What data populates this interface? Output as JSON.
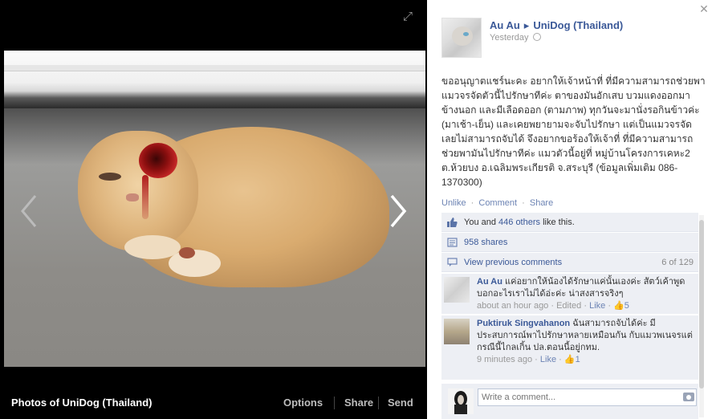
{
  "stage": {
    "album_title": "Photos of UniDog (Thailand)",
    "options_label": "Options",
    "share_label": "Share",
    "send_label": "Send"
  },
  "post": {
    "author": "Au Au",
    "target_page": "UniDog (Thailand)",
    "time": "Yesterday",
    "text": "ขออนุญาตแชร์นะคะ อยากให้เจ้าหน้าที่ ที่มีความสามารถช่วยพาแมวจรจัดตัวนี้ไปรักษาทีค่ะ ตาของมันอักเสบ บวมแดงออกมาข้างนอก และมีเลือดออก (ตามภาพ) ทุกวันจะมานั่งรอกินข้าวค่ะ (มาเช้า-เย็น) และเคยพยายามจะจับไปรักษา แต่เป็นแมวจรจัดเลยไม่สามารถจับได้ จึงอยากขอร้องให้เจ้าที่ ที่มีความสามารถ ช่วยพามันไปรักษาทีค่ะ แมวตัวนี้อยู่ที่ หมู่บ้านโครงการเคหะ2 ต.ห้วยบง อ.เฉลิมพระเกียรติ จ.สระบุรี (ข้อมูลเพิ่มเติม 086-1370300)",
    "actions": {
      "unlike": "Unlike",
      "comment": "Comment",
      "share": "Share",
      "sep": "·"
    }
  },
  "ufi": {
    "likes_you": "You and ",
    "likes_others": "446 others",
    "likes_tail": " like this.",
    "shares": "958 shares",
    "view_previous": "View previous comments",
    "comment_count": "6 of 129"
  },
  "comments": [
    {
      "name": "Au Au",
      "text": "แค่อยากให้น้องได้รักษาแค่นั้นเองค่ะ สัตว์เค้าพูดบอกอะไรเราไม่ได้อ่ะค่ะ น่าสงสารจริงๆ",
      "time": "about an hour ago",
      "edited": "Edited",
      "like": "Like",
      "likes": "5"
    },
    {
      "name": "Puktiruk Singvahanon",
      "text": "ฉันสามารถจับได้ค่ะ มีประสบการณ์พาไปรักษาหลายเหมือนกัน กับแมวพเนจรแต่กรณีนี้ไกลเกิ้น ปล.ตอนนี้อยู่กทม.",
      "time": "9 minutes ago",
      "like": "Like",
      "likes": "1"
    }
  ],
  "write": {
    "placeholder": "Write a comment..."
  },
  "colors": {
    "fb_blue": "#3b5998",
    "link_blue": "#6d84b4",
    "ufi_bg": "#edeff4"
  }
}
